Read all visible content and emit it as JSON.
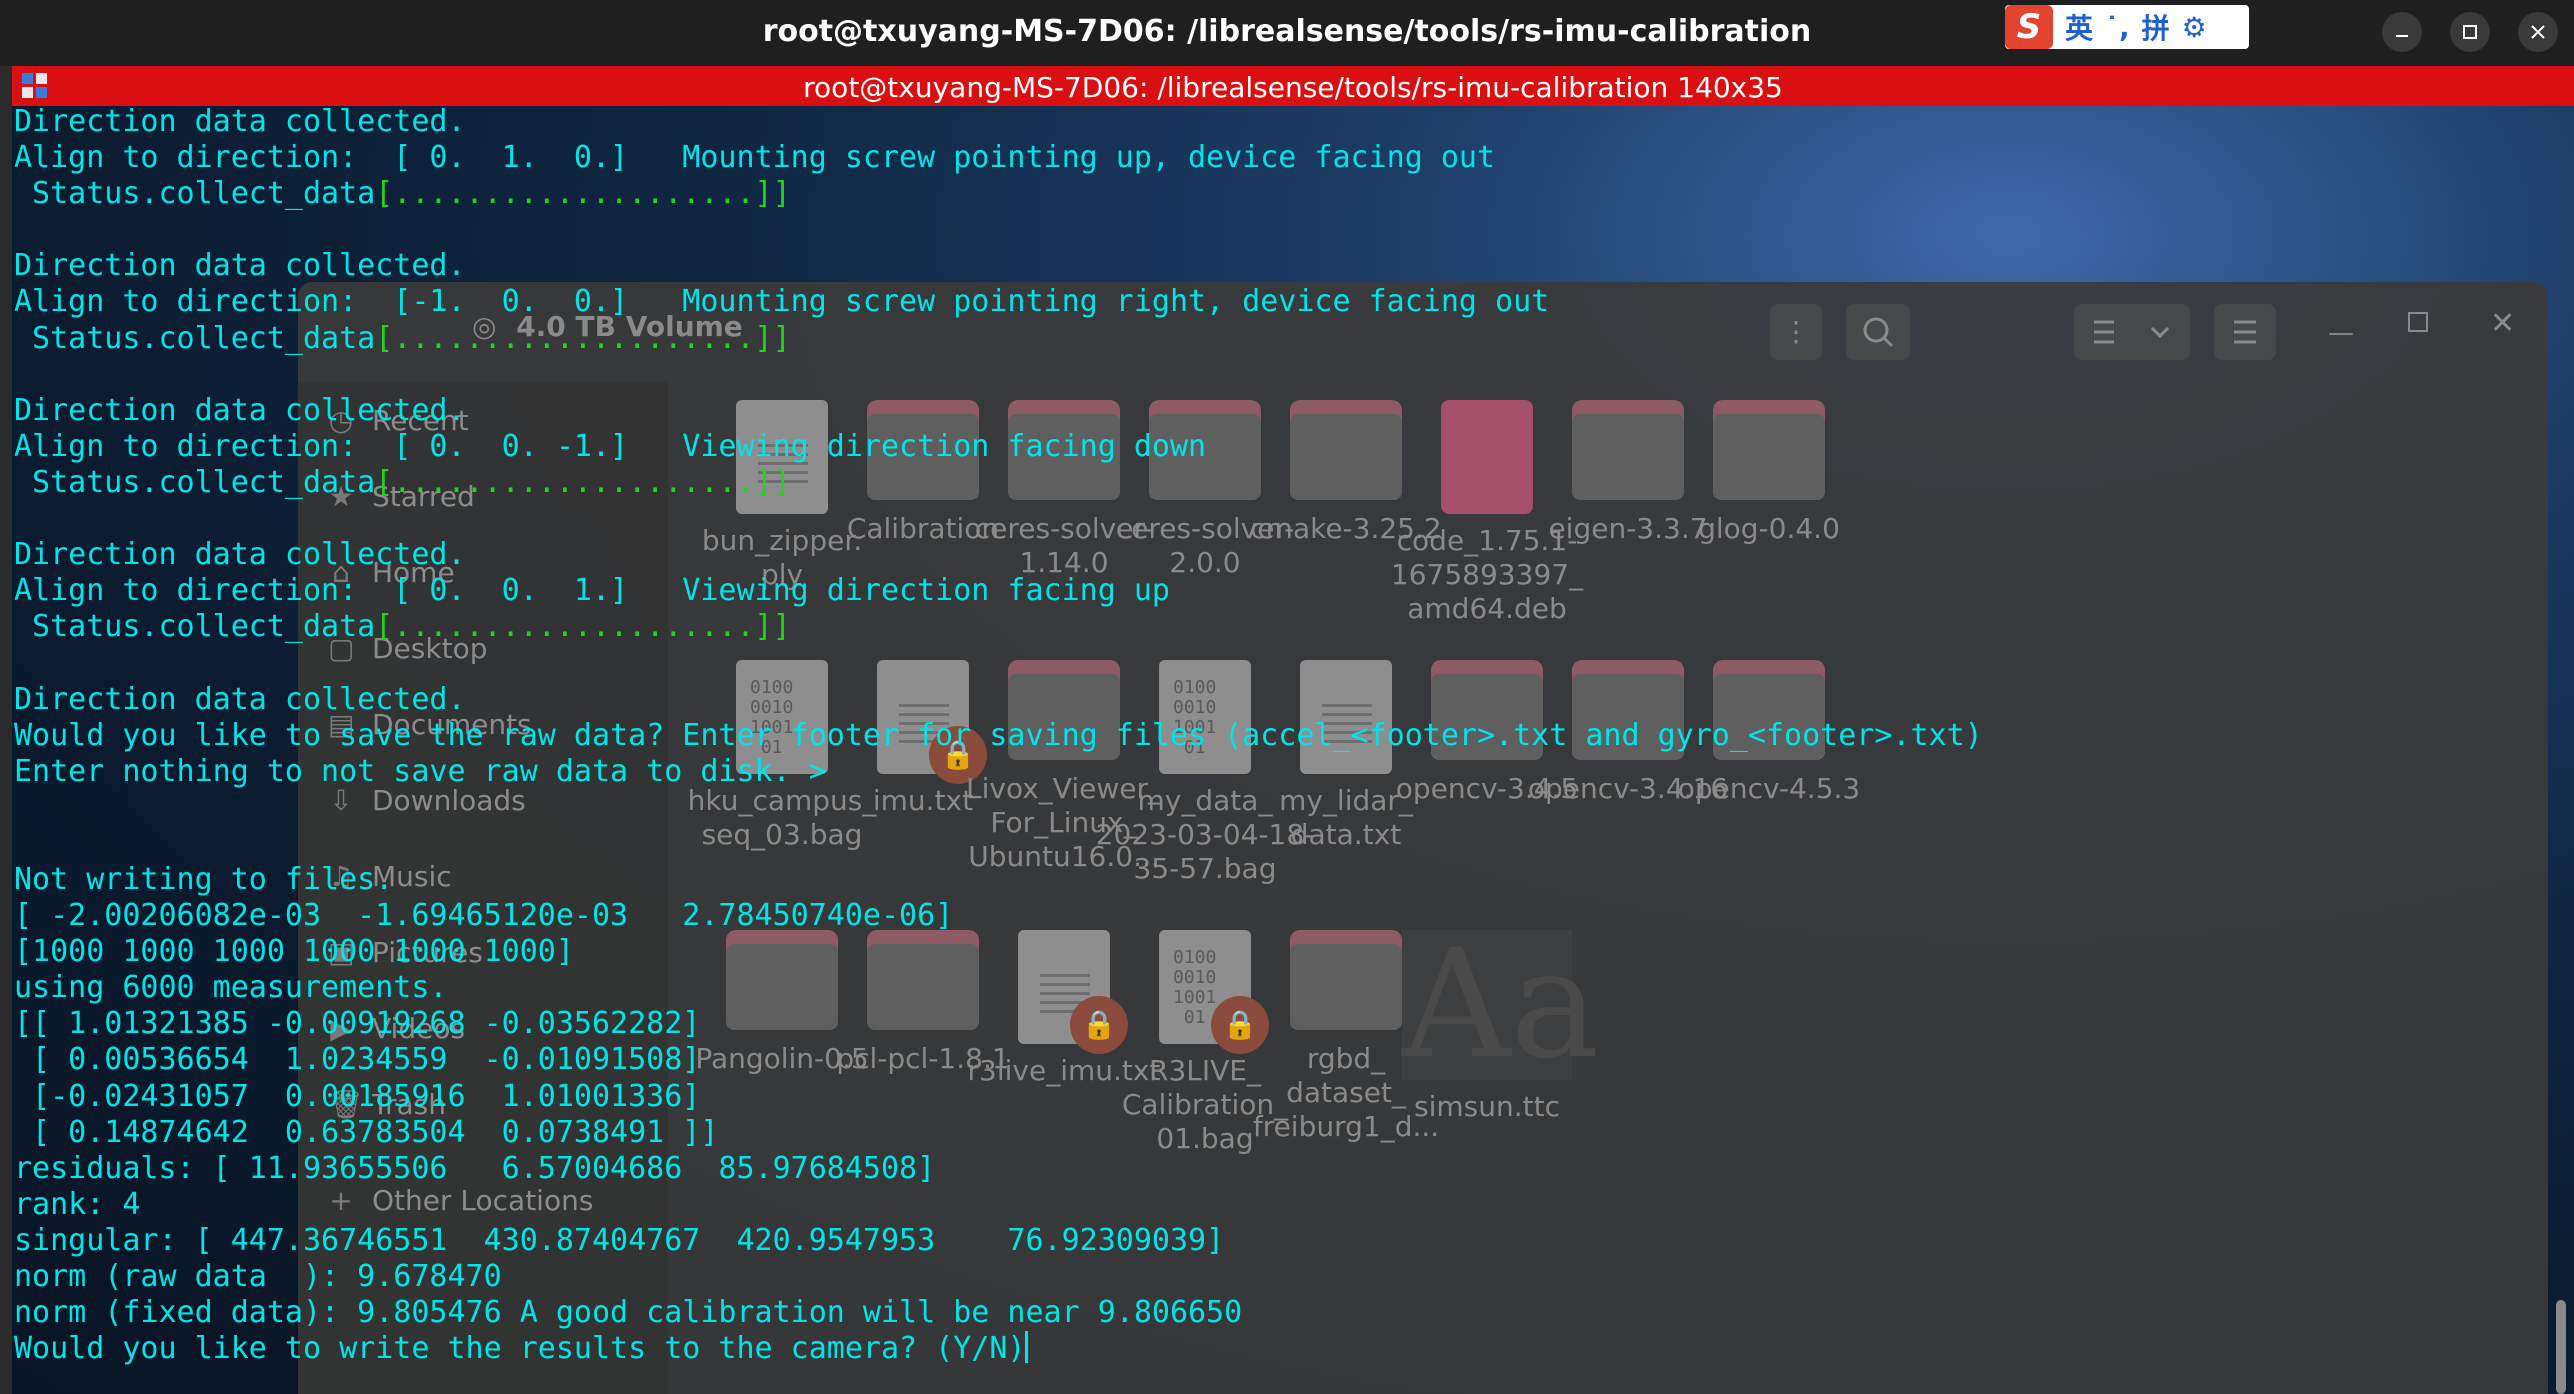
{
  "window": {
    "title": "root@txuyang-MS-7D06: /librealsense/tools/rs-imu-calibration",
    "minimize_icon": "minimize-icon",
    "maximize_icon": "maximize-icon",
    "close_icon": "close-icon"
  },
  "ime": {
    "logo": "S",
    "items": [
      "英",
      "˙,",
      "拼",
      "⚙"
    ]
  },
  "terminal_tab": {
    "title": "root@txuyang-MS-7D06: /librealsense/tools/rs-imu-calibration 140x35"
  },
  "terminal": {
    "lines": [
      "Direction data collected.",
      "Align to direction:  [ 0.  1.  0.]   Mounting screw pointing up, device facing out",
      " Status.collect_data[....................]]",
      "",
      "Direction data collected.",
      "Align to direction:  [-1.  0.  0.]   Mounting screw pointing right, device facing out",
      " Status.collect_data[....................]]",
      "",
      "Direction data collected.",
      "Align to direction:  [ 0.  0. -1.]   Viewing direction facing down",
      " Status.collect_data[....................]]",
      "",
      "Direction data collected.",
      "Align to direction:  [ 0.  0.  1.]   Viewing direction facing up",
      " Status.collect_data[....................]]",
      "",
      "Direction data collected.",
      "Would you like to save the raw data? Enter footer for saving files (accel_<footer>.txt and gyro_<footer>.txt)",
      "Enter nothing to not save raw data to disk. >",
      "",
      "",
      "Not writing to files.",
      "[ -2.00206082e-03  -1.69465120e-03   2.78450740e-06]",
      "[1000 1000 1000 1000 1000 1000]",
      "using 6000 measurements.",
      "[[ 1.01321385 -0.00919268 -0.03562282]",
      " [ 0.00536654  1.0234559  -0.01091508]",
      " [-0.02431057  0.00185916  1.01001336]",
      " [ 0.14874642  0.63783504  0.0738491 ]]",
      "residuals: [ 11.93655506   6.57004686  85.97684508]",
      "rank: 4",
      "singular: [ 447.36746551  430.87404767  420.9547953    76.92309039]",
      "norm (raw data  ): 9.678470",
      "norm (fixed data): 9.805476 A good calibration will be near 9.806650",
      "Would you like to write the results to the camera? (Y/N)"
    ]
  },
  "file_manager": {
    "location": "4.0 TB Volume",
    "sidebar": [
      {
        "label": "Recent",
        "icon": "clock-icon"
      },
      {
        "label": "Starred",
        "icon": "star-icon"
      },
      {
        "label": "Home",
        "icon": "home-icon"
      },
      {
        "label": "Desktop",
        "icon": "desktop-icon"
      },
      {
        "label": "Documents",
        "icon": "documents-icon"
      },
      {
        "label": "Downloads",
        "icon": "download-icon"
      },
      {
        "label": "Music",
        "icon": "music-icon"
      },
      {
        "label": "Pictures",
        "icon": "pictures-icon"
      },
      {
        "label": "Videos",
        "icon": "videos-icon"
      },
      {
        "label": "Trash",
        "icon": "trash-icon"
      },
      {
        "label": "Other Locations",
        "icon": "plus-icon"
      }
    ],
    "files": [
      {
        "name": "bun_zipper.\nply",
        "kind": "doc"
      },
      {
        "name": "Calibration",
        "kind": "folder"
      },
      {
        "name": "ceres-solver-\n1.14.0",
        "kind": "folder"
      },
      {
        "name": "ceres-solver-\n2.0.0",
        "kind": "folder"
      },
      {
        "name": "cmake-3.25.2",
        "kind": "folder"
      },
      {
        "name": "code_1.75.1-\n1675893397_\namd64.deb",
        "kind": "deb"
      },
      {
        "name": "eigen-3.3.7",
        "kind": "folder"
      },
      {
        "name": "glog-0.4.0",
        "kind": "folder"
      },
      {
        "name": "hku_campus_\nseq_03.bag",
        "kind": "bin"
      },
      {
        "name": "imu.txt",
        "kind": "doc-lock"
      },
      {
        "name": "Livox_Viewer_\nFor_Linux_\nUbuntu16.0...",
        "kind": "folder"
      },
      {
        "name": "my_data_\n2023-03-04-18-\n35-57.bag",
        "kind": "bin"
      },
      {
        "name": "my_lidar_\ndata.txt",
        "kind": "doc"
      },
      {
        "name": "opencv-3.4.5",
        "kind": "folder"
      },
      {
        "name": "opencv-3.4.16",
        "kind": "folder"
      },
      {
        "name": "opencv-4.5.3",
        "kind": "folder"
      },
      {
        "name": "Pangolin-0.5",
        "kind": "folder"
      },
      {
        "name": "pcl-pcl-1.8.1",
        "kind": "folder"
      },
      {
        "name": "r3live_imu.txt",
        "kind": "doc-lock"
      },
      {
        "name": "R3LIVE_\nCalibration_\n01.bag",
        "kind": "bin-lock"
      },
      {
        "name": "rgbd_\ndataset_\nfreiburg1_d...",
        "kind": "folder"
      },
      {
        "name": "simsun.ttc",
        "kind": "font"
      }
    ]
  },
  "colors": {
    "terminal_text": "#00e5e8",
    "progress_green": "#22d321",
    "tab_bar_red": "#d90f12",
    "title_bar": "#1f1f1f"
  }
}
